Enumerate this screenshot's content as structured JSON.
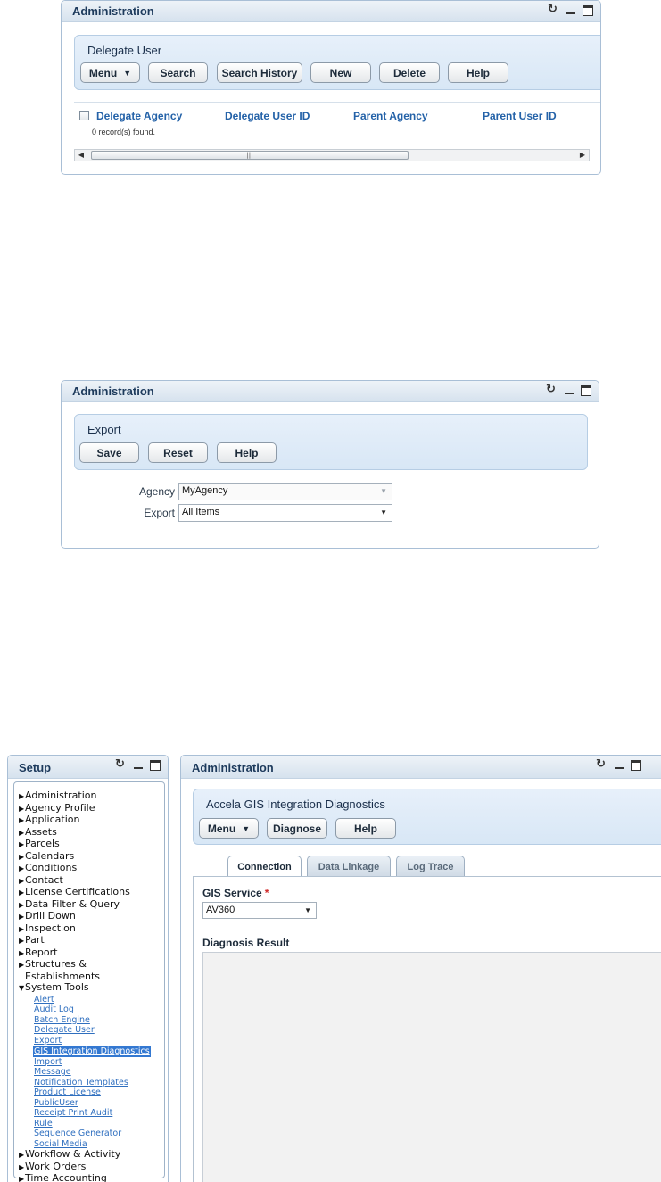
{
  "panel1": {
    "title": "Administration",
    "toolbar_title": "Delegate User",
    "buttons": {
      "menu": "Menu",
      "search": "Search",
      "search_history": "Search History",
      "new": "New",
      "delete": "Delete",
      "help": "Help"
    },
    "columns": [
      "Delegate Agency",
      "Delegate User ID",
      "Parent Agency",
      "Parent User ID"
    ],
    "status": "0 record(s) found."
  },
  "panel2": {
    "title": "Administration",
    "toolbar_title": "Export",
    "buttons": {
      "save": "Save",
      "reset": "Reset",
      "help": "Help"
    },
    "agency_label": "Agency",
    "agency_value": "MyAgency",
    "export_label": "Export",
    "export_value": "All Items"
  },
  "setup": {
    "title": "Setup",
    "tree": {
      "top_before": [
        "Administration",
        "Agency Profile",
        "Application",
        "Assets",
        "Parcels",
        "Calendars",
        "Conditions",
        "Contact",
        "License Certifications",
        "Data Filter & Query",
        "Drill Down",
        "Inspection",
        "Part",
        "Report"
      ],
      "structures_line1": "Structures &",
      "structures_line2": "Establishments",
      "system_tools": "System Tools",
      "system_children": [
        "Alert",
        "Audit Log",
        "Batch Engine",
        "Delegate User",
        "Export",
        "GIS Integration Diagnostics",
        "Import",
        "Message",
        "Notification Templates",
        "Product License",
        "PublicUser",
        "Receipt Print Audit",
        "Rule",
        "Sequence Generator",
        "Social Media"
      ],
      "selected_child": "GIS Integration Diagnostics",
      "top_after": [
        "Workflow & Activity",
        "Work Orders",
        "Time Accounting"
      ]
    }
  },
  "panel3": {
    "title": "Administration",
    "toolbar_title": "Accela GIS Integration Diagnostics",
    "buttons": {
      "menu": "Menu",
      "diagnose": "Diagnose",
      "help": "Help"
    },
    "tabs": [
      "Connection",
      "Data Linkage",
      "Log Trace"
    ],
    "active_tab": "Connection",
    "gis_service_label": "GIS Service",
    "required_mark": "*",
    "gis_service_value": "AV360",
    "diagnosis_label": "Diagnosis Result"
  }
}
